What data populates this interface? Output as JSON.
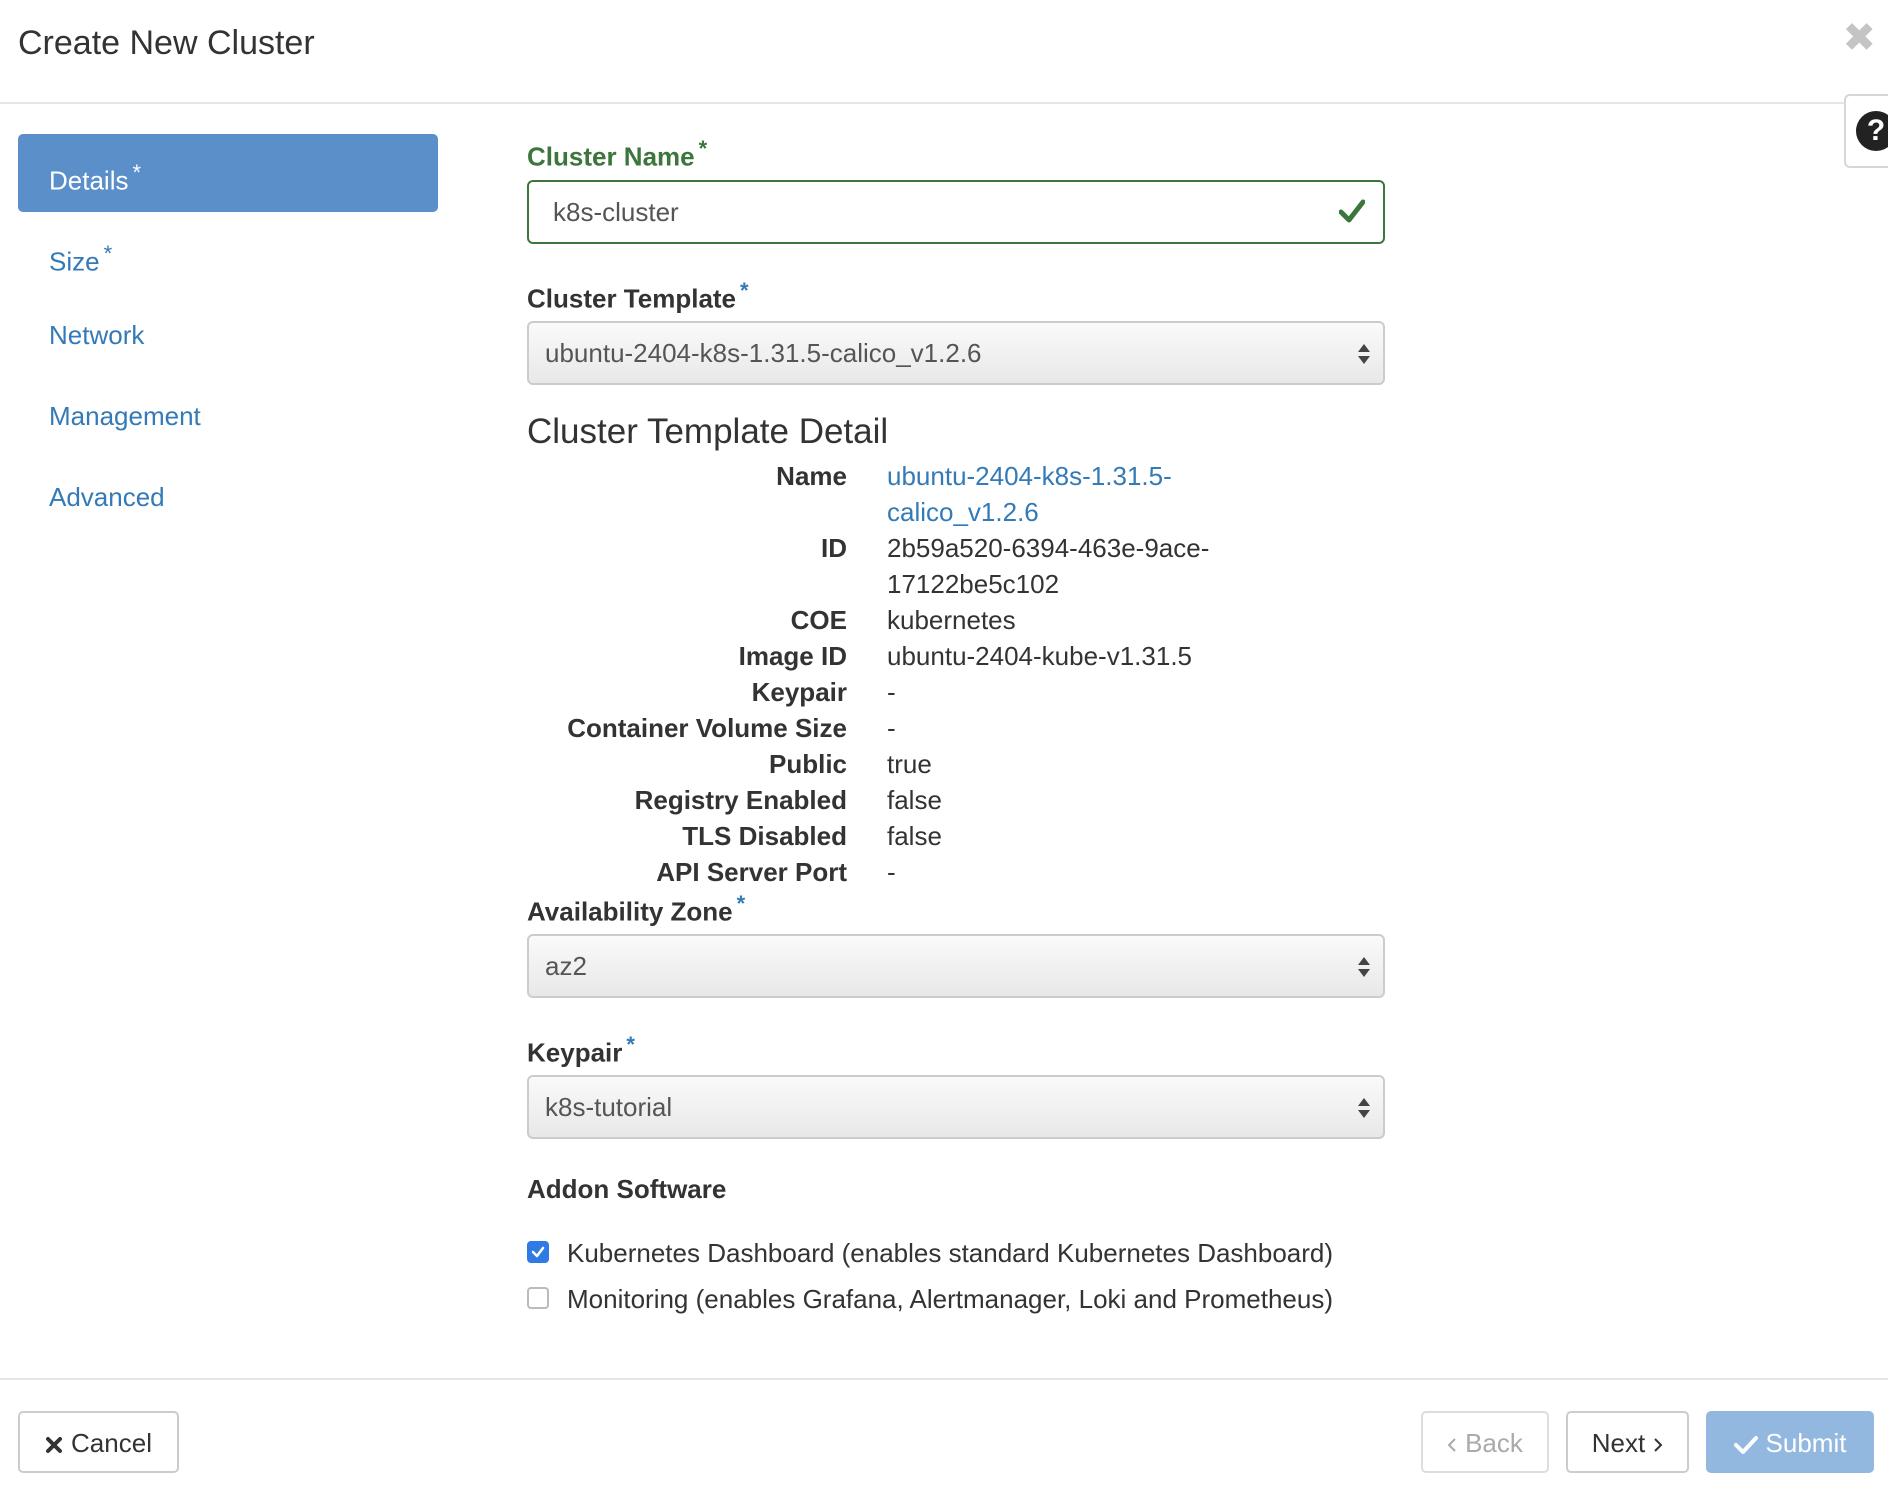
{
  "header": {
    "title": "Create New Cluster",
    "close_icon": "close-icon",
    "help_icon": "question-circle-icon",
    "help_glyph": "?"
  },
  "sidebar": {
    "items": [
      {
        "label": "Details",
        "required": "*",
        "active": true
      },
      {
        "label": "Size",
        "required": "*",
        "active": false
      },
      {
        "label": "Network",
        "required": "",
        "active": false
      },
      {
        "label": "Management",
        "required": "",
        "active": false
      },
      {
        "label": "Advanced",
        "required": "",
        "active": false
      }
    ]
  },
  "form": {
    "cluster_name": {
      "label": "Cluster Name",
      "required": "*",
      "value": "k8s-cluster"
    },
    "cluster_template": {
      "label": "Cluster Template",
      "required": "*",
      "value": "ubuntu-2404-k8s-1.31.5-calico_v1.2.6"
    },
    "template_detail": {
      "title": "Cluster Template Detail",
      "rows": [
        {
          "term": "Name",
          "value": "ubuntu-2404-k8s-1.31.5-calico_v1.2.6"
        },
        {
          "term": "ID",
          "value": "2b59a520-6394-463e-9ace-17122be5c102"
        },
        {
          "term": "COE",
          "value": "kubernetes"
        },
        {
          "term": "Image ID",
          "value": "ubuntu-2404-kube-v1.31.5"
        },
        {
          "term": "Keypair",
          "value": "-"
        },
        {
          "term": "Container Volume Size",
          "value": "-"
        },
        {
          "term": "Public",
          "value": "true"
        },
        {
          "term": "Registry Enabled",
          "value": "false"
        },
        {
          "term": "TLS Disabled",
          "value": "false"
        },
        {
          "term": "API Server Port",
          "value": "-"
        }
      ]
    },
    "availability_zone": {
      "label": "Availability Zone",
      "required": "*",
      "value": "az2"
    },
    "keypair": {
      "label": "Keypair",
      "required": "*",
      "value": "k8s-tutorial"
    },
    "addon": {
      "title": "Addon Software",
      "items": [
        {
          "label": "Kubernetes Dashboard (enables standard Kubernetes Dashboard)",
          "checked": true
        },
        {
          "label": "Monitoring (enables Grafana, Alertmanager, Loki and Prometheus)",
          "checked": false
        }
      ]
    }
  },
  "footer": {
    "cancel_label": "Cancel",
    "back_label": "Back",
    "next_label": "Next",
    "submit_label": "Submit"
  },
  "colors": {
    "accent": "#337ab7",
    "active_nav": "#5a8fc9",
    "success": "#3c763d",
    "submit": "#93b8e0"
  }
}
